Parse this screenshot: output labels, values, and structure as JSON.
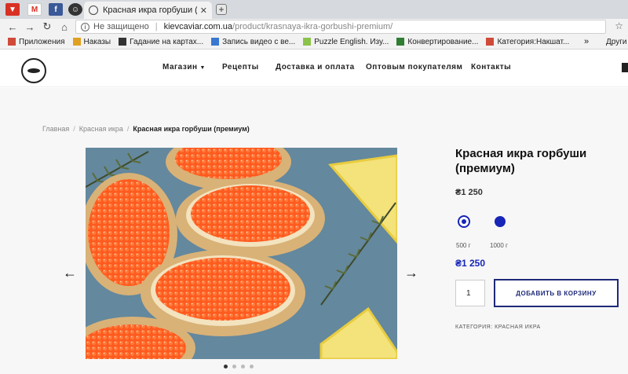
{
  "browser": {
    "active_tab_title": "Красная икра горбуши (премиум)",
    "address": {
      "security_label": "Не защищено",
      "host": "kievcaviar.com.ua",
      "path": "/product/krasnaya-ikra-gorbushi-premium/"
    },
    "bookmarks": [
      {
        "label": "Приложения",
        "icon": "apps-icon",
        "color": "#d04a3a"
      },
      {
        "label": "Наказы",
        "icon": "bookmark-icon",
        "color": "#e0a020"
      },
      {
        "label": "Гадание на картах...",
        "icon": "cards-icon",
        "color": "#333333"
      },
      {
        "label": "Запись видео с ве...",
        "icon": "video-icon",
        "color": "#3a77d0"
      },
      {
        "label": "Puzzle English. Изу...",
        "icon": "puzzle-icon",
        "color": "#8bc34a"
      },
      {
        "label": "Конвертирование...",
        "icon": "convert-icon",
        "color": "#2e7d32"
      },
      {
        "label": "Категория:Накшат...",
        "icon": "wiki-icon",
        "color": "#d04a3a"
      }
    ],
    "bookmarks_overflow": "»",
    "bookmarks_other": "Други"
  },
  "site": {
    "nav": {
      "shop": "Магазин",
      "recipes": "Рецепты",
      "delivery": "Доставка и оплата",
      "wholesale": "Оптовым покупателям",
      "contacts": "Контакты"
    }
  },
  "breadcrumb": {
    "home": "Главная",
    "category": "Красная икра",
    "current": "Красная икра горбуши (премиум)"
  },
  "gallery": {
    "prev": "←",
    "next": "→",
    "total_slides": 4,
    "active_slide": 1
  },
  "product": {
    "title": "Красная икра горбуши (премиум)",
    "price": "₴1 250",
    "variants": [
      {
        "label": "500 г",
        "selected": true
      },
      {
        "label": "1000 г",
        "selected": false
      }
    ],
    "selected_price": "₴1 250",
    "quantity": "1",
    "add_to_cart": "ДОБАВИТЬ В КОРЗИНУ",
    "category_label": "КАТЕГОРИЯ:",
    "category_value": "КРАСНАЯ ИКРА"
  },
  "colors": {
    "accent": "#1725b8",
    "button_border": "#1f2a7a",
    "caviar": "#ff5a1f"
  }
}
